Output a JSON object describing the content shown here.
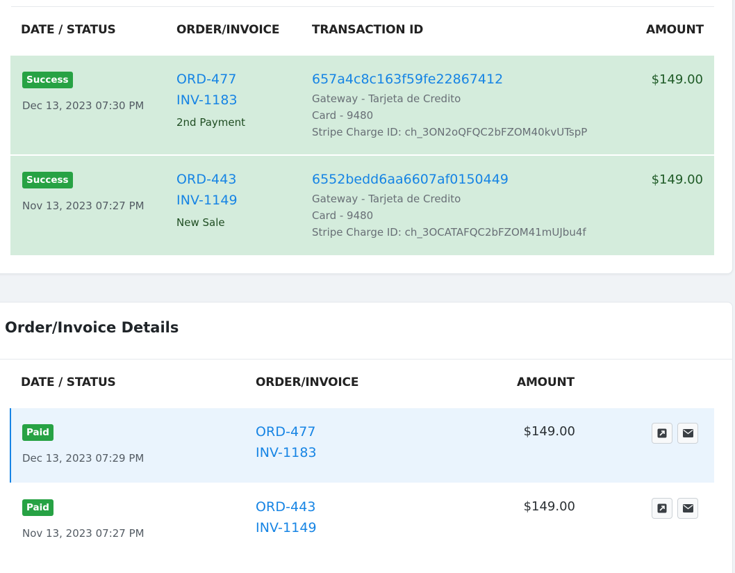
{
  "transactions": {
    "headers": {
      "date_status": "DATE / STATUS",
      "order_invoice": "ORDER/INVOICE",
      "transaction_id": "TRANSACTION ID",
      "amount": "AMOUNT"
    },
    "rows": [
      {
        "status": "Success",
        "date": "Dec 13, 2023 07:30 PM",
        "order": "ORD-477",
        "invoice": "INV-1183",
        "note": "2nd Payment",
        "txid": "657a4c8c163f59fe22867412",
        "gateway": "Gateway - Tarjeta de Credito",
        "card": "Card - 9480",
        "stripe": "Stripe Charge ID: ch_3ON2oQFQC2bFZOM40kvUTspP",
        "amount": "$149.00"
      },
      {
        "status": "Success",
        "date": "Nov 13, 2023 07:27 PM",
        "order": "ORD-443",
        "invoice": "INV-1149",
        "note": "New Sale",
        "txid": "6552bedd6aa6607af0150449",
        "gateway": "Gateway - Tarjeta de Credito",
        "card": "Card - 9480",
        "stripe": "Stripe Charge ID: ch_3OCATAFQC2bFZOM41mUJbu4f",
        "amount": "$149.00"
      }
    ]
  },
  "details": {
    "title": "Order/Invoice Details",
    "headers": {
      "date_status": "DATE / STATUS",
      "order_invoice": "ORDER/INVOICE",
      "amount": "AMOUNT"
    },
    "rows": [
      {
        "status": "Paid",
        "date": "Dec 13, 2023 07:29 PM",
        "order": "ORD-477",
        "invoice": "INV-1183",
        "amount": "$149.00"
      },
      {
        "status": "Paid",
        "date": "Nov 13, 2023 07:27 PM",
        "order": "ORD-443",
        "invoice": "INV-1149",
        "amount": "$149.00"
      }
    ],
    "row_icons": [
      "open-external-icon",
      "envelope-icon"
    ]
  },
  "colors": {
    "success_badge": "#27a244",
    "success_row_bg": "#d4ecdc",
    "selected_row_bg": "#eaf4fd",
    "selected_row_accent": "#1684e4",
    "link": "#1684e4"
  }
}
